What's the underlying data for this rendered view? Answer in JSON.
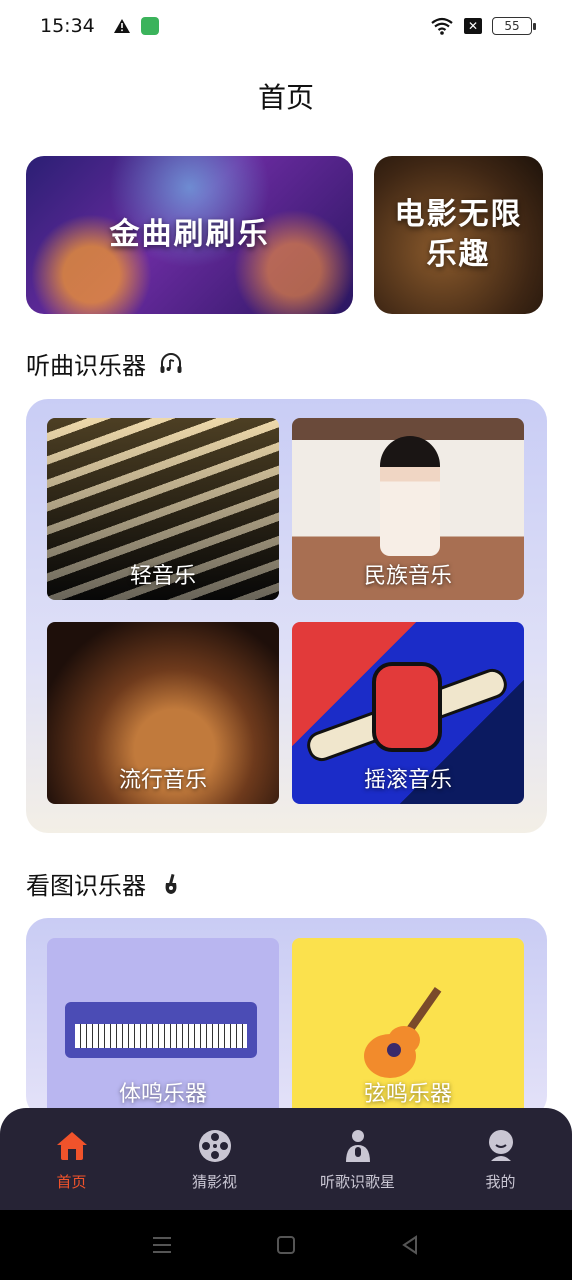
{
  "status": {
    "time": "15:34",
    "battery": "55",
    "x_box": "✕"
  },
  "page": {
    "title": "首页"
  },
  "banners": [
    {
      "label": "金曲刷刷乐"
    },
    {
      "line1": "电影无限",
      "line2": "乐趣"
    }
  ],
  "sections": {
    "listen": {
      "title": "听曲识乐器",
      "icon": "headphone-note-icon",
      "tiles": [
        {
          "label": "轻音乐"
        },
        {
          "label": "民族音乐"
        },
        {
          "label": "流行音乐"
        },
        {
          "label": "摇滚音乐"
        }
      ]
    },
    "image": {
      "title": "看图识乐器",
      "icon": "guitar-pick-icon",
      "tiles": [
        {
          "label": "体鸣乐器"
        },
        {
          "label": "弦鸣乐器"
        }
      ]
    }
  },
  "tabs": [
    {
      "label": "首页",
      "icon": "home-icon",
      "active": true
    },
    {
      "label": "猜影视",
      "icon": "film-reel-icon",
      "active": false
    },
    {
      "label": "听歌识歌星",
      "icon": "singer-mic-icon",
      "active": false
    },
    {
      "label": "我的",
      "icon": "profile-icon",
      "active": false
    }
  ],
  "colors": {
    "accent": "#f0532b",
    "tab_bar": "#262335",
    "tab_inactive": "#c9c6d3"
  }
}
